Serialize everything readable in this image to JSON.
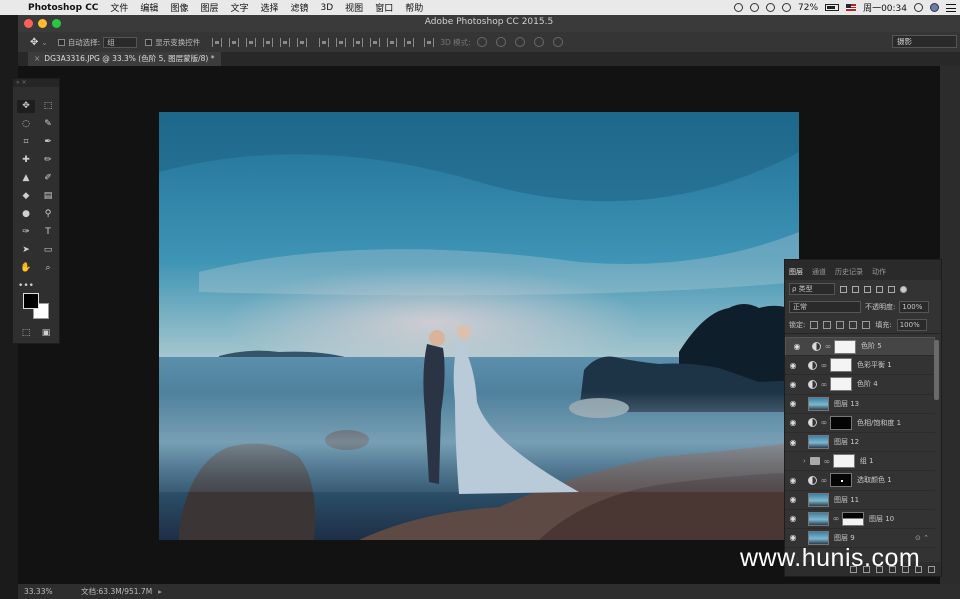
{
  "menubar": {
    "app_name": "Photoshop CC",
    "items": [
      "文件",
      "编辑",
      "图像",
      "图层",
      "文字",
      "选择",
      "滤镜",
      "3D",
      "视图",
      "窗口",
      "帮助"
    ],
    "battery": "72%",
    "clock": "周一00:34"
  },
  "window": {
    "title": "Adobe Photoshop CC 2015.5"
  },
  "options_bar": {
    "auto_select_label": "自动选择:",
    "auto_select_value": "组",
    "show_transform_label": "显示变换控件",
    "mode_3d_label": "3D 模式:",
    "workspace": "摄影"
  },
  "document_tab": {
    "label": "DG3A3316.JPG @ 33.3% (色阶 5, 图层蒙版/8) *"
  },
  "layers_panel": {
    "tabs": [
      "图层",
      "通道",
      "历史记录",
      "动作"
    ],
    "filter_label": "ρ 类型",
    "blend_mode": "正常",
    "opacity_label": "不透明度:",
    "opacity_value": "100%",
    "lock_label": "锁定:",
    "fill_label": "填充:",
    "fill_value": "100%",
    "layers": [
      {
        "name": "色阶 5"
      },
      {
        "name": "色彩平衡 1"
      },
      {
        "name": "色阶 4"
      },
      {
        "name": "图层 13"
      },
      {
        "name": "色相/饱和度 1"
      },
      {
        "name": "图层 12"
      },
      {
        "name": "组 1"
      },
      {
        "name": "选取颜色 1"
      },
      {
        "name": "图层 11"
      },
      {
        "name": "图层 10"
      },
      {
        "name": "图层 9"
      }
    ]
  },
  "status_bar": {
    "zoom": "33.33%",
    "doc_info": "文档:63.3M/951.7M"
  },
  "watermark": "www.hunis.com",
  "colors": {
    "foreground": "#000000",
    "background": "#ffffff",
    "panel": "#333333",
    "canvas": "#121212"
  }
}
